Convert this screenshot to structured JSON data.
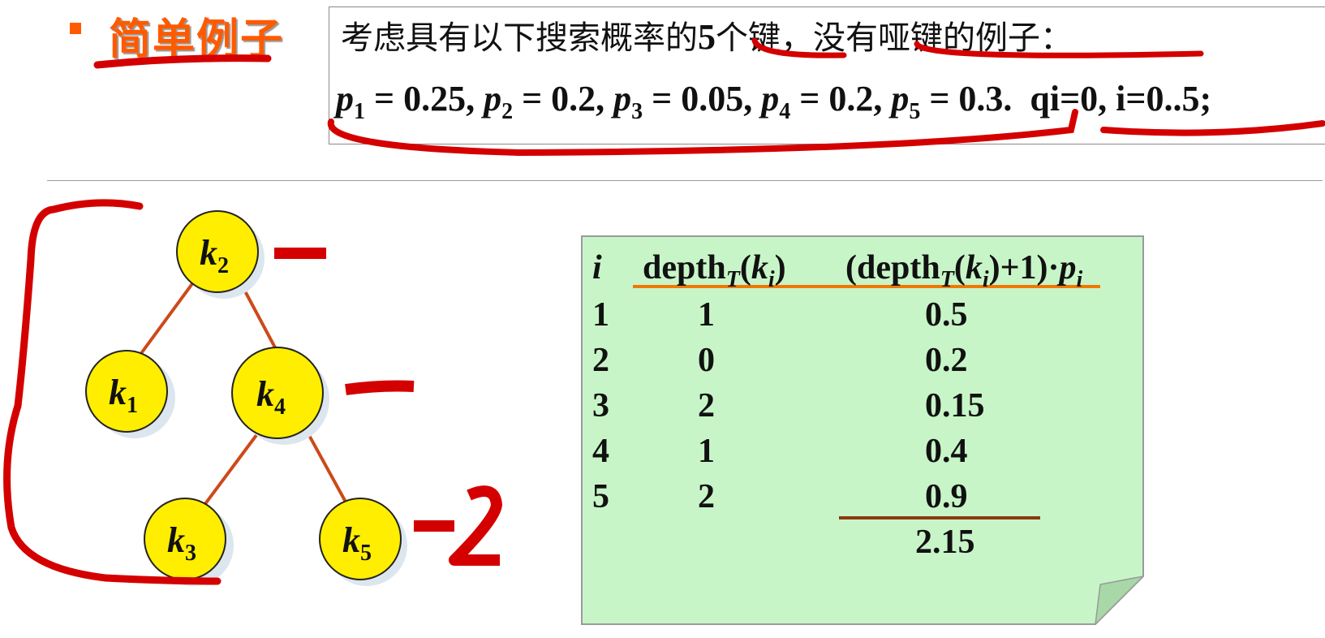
{
  "header": {
    "title": "简单例子",
    "intro_text_a": "考虑具有以下搜索概率的",
    "intro_num": "5",
    "intro_text_b": "个键，没有哑键的例子：",
    "probabilities": [
      {
        "sym": "p",
        "idx": "1",
        "val": "0.25"
      },
      {
        "sym": "p",
        "idx": "2",
        "val": "0.2"
      },
      {
        "sym": "p",
        "idx": "3",
        "val": "0.05"
      },
      {
        "sym": "p",
        "idx": "4",
        "val": "0.2"
      },
      {
        "sym": "p",
        "idx": "5",
        "val": "0.3"
      }
    ],
    "dummy_text": "qi=0,  i=0..5;"
  },
  "tree": {
    "nodes": [
      {
        "id": "k2",
        "sym": "k",
        "idx": "2"
      },
      {
        "id": "k1",
        "sym": "k",
        "idx": "1"
      },
      {
        "id": "k4",
        "sym": "k",
        "idx": "4"
      },
      {
        "id": "k3",
        "sym": "k",
        "idx": "3"
      },
      {
        "id": "k5",
        "sym": "k",
        "idx": "5"
      }
    ],
    "node_color": "#ffee00",
    "edge_color": "#cc4a1a"
  },
  "table": {
    "headers": {
      "i": "i",
      "depth_a": "depth",
      "depth_sub": "T",
      "depth_b": "(",
      "depth_k": "k",
      "depth_ki": "i",
      "depth_c": ")",
      "cost_a": "(depth",
      "cost_sub": "T",
      "cost_b": "(",
      "cost_k": "k",
      "cost_ki": "i",
      "cost_c": ")+1)·",
      "cost_p": "p",
      "cost_pi": "i"
    },
    "rows": [
      {
        "i": "1",
        "depth": "1",
        "cost": "0.5"
      },
      {
        "i": "2",
        "depth": "0",
        "cost": "0.2"
      },
      {
        "i": "3",
        "depth": "2",
        "cost": "0.15"
      },
      {
        "i": "4",
        "depth": "1",
        "cost": "0.4"
      },
      {
        "i": "5",
        "depth": "2",
        "cost": "0.9"
      }
    ],
    "total": "2.15",
    "background": "#c8f5c8"
  },
  "colors": {
    "title": "#ff5a00",
    "annotation": "#d40000",
    "underline": "#f07800"
  }
}
